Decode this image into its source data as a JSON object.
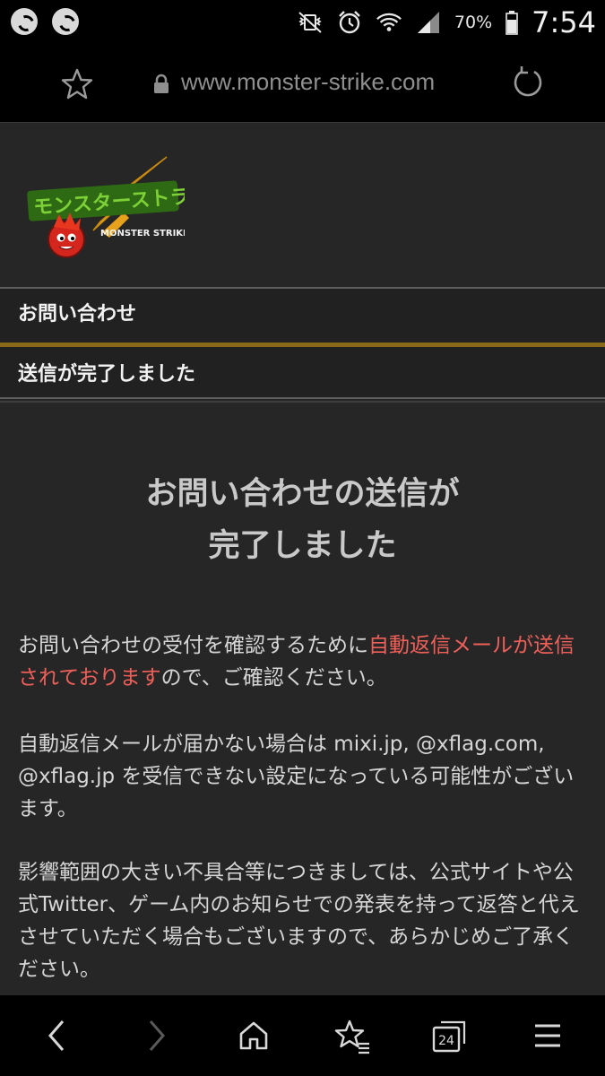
{
  "status_bar": {
    "left_icons": [
      "app-notification-icon",
      "app-notification-icon"
    ],
    "right_icons": [
      "mute-vibrate-icon",
      "alarm-icon",
      "wifi-icon",
      "cell-signal-icon"
    ],
    "battery_percent": "70%",
    "time": "7:54"
  },
  "browser": {
    "url": "www.monster-strike.com",
    "bookmark_icon": "star-icon",
    "secure_icon": "lock-icon",
    "reload_icon": "reload-icon"
  },
  "logo": {
    "jp_text": "モンスターストライク",
    "en_text": "MONSTER STRIKE"
  },
  "sections": {
    "inquiry_label": "お問い合わせ",
    "sent_label": "送信が完了しました"
  },
  "main": {
    "title_line1": "お問い合わせの送信が",
    "title_line2": "完了しました",
    "para1_pre": "お問い合わせの受付を確認するために",
    "para1_highlight": "自動返信メールが送信されております",
    "para1_post": "ので、ご確認ください。",
    "para2": "自動返信メールが届かない場合は mixi.jp, @xflag.com, @xflag.jp を受信できない設定になっている可能性がございます。",
    "para3": "影響範囲の大きい不具合等につきましては、公式サイトや公式Twitter、ゲーム内のお知らせでの発表を持って返答と代えさせていただく場合もございますので、あらかじめご了承ください。"
  },
  "bottom_nav": {
    "tabs_count": "24",
    "icons": [
      "back-icon",
      "forward-icon",
      "home-icon",
      "bookmarks-icon",
      "tabs-icon",
      "menu-icon"
    ]
  },
  "colors": {
    "background": "#262626",
    "highlight": "#f0605a",
    "gold_divider": "#8b6a17"
  }
}
